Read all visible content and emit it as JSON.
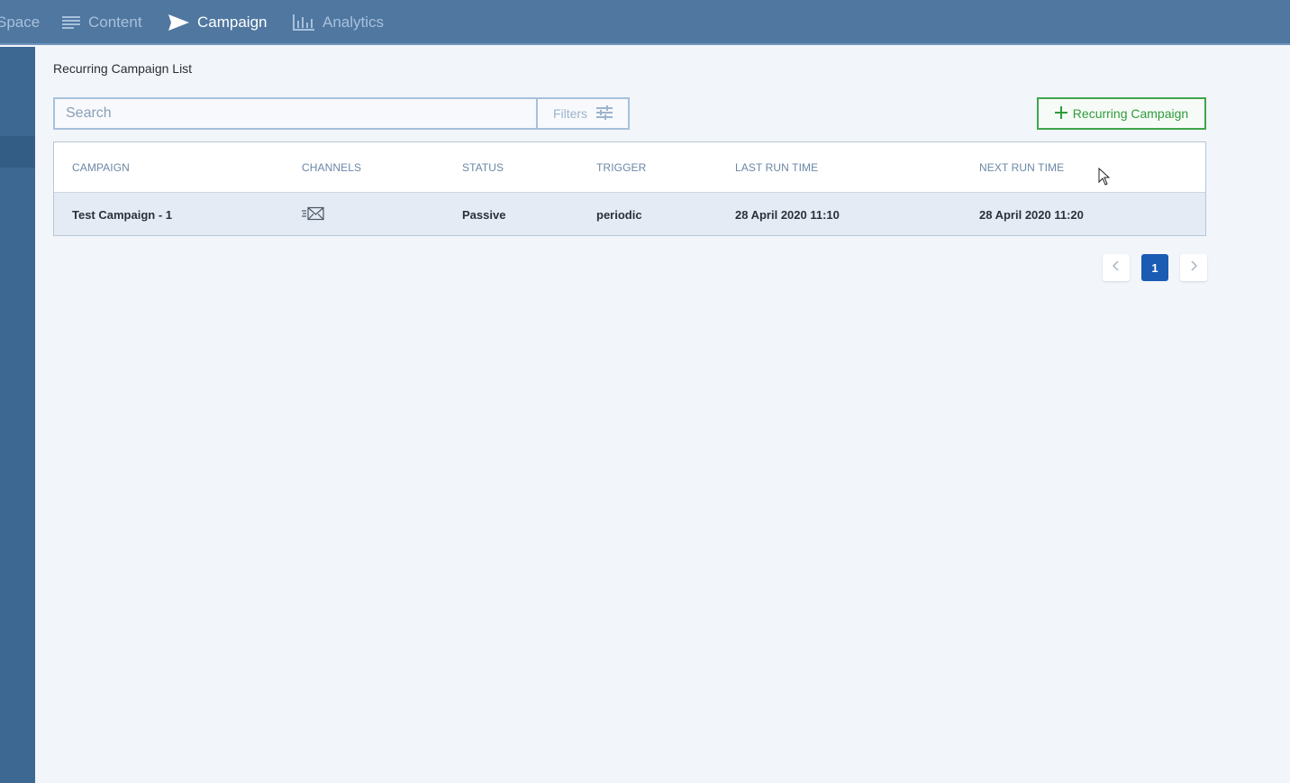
{
  "nav": {
    "items": [
      {
        "label": "Space",
        "icon": "workspace-icon",
        "active": false
      },
      {
        "label": "Content",
        "icon": "content-lines-icon",
        "active": false
      },
      {
        "label": "Campaign",
        "icon": "paper-plane-icon",
        "active": true
      },
      {
        "label": "Analytics",
        "icon": "bar-chart-icon",
        "active": false
      }
    ]
  },
  "page": {
    "title": "Recurring Campaign List"
  },
  "toolbar": {
    "search_placeholder": "Search",
    "search_value": "",
    "filters_label": "Filters",
    "add_label": "Recurring Campaign"
  },
  "table": {
    "columns": [
      "CAMPAIGN",
      "CHANNELS",
      "STATUS",
      "TRIGGER",
      "LAST RUN TIME",
      "NEXT RUN TIME"
    ],
    "rows": [
      {
        "campaign": "Test Campaign - 1",
        "channel_icon": "email-icon",
        "status": "Passive",
        "trigger": "periodic",
        "last_run": "28 April 2020 11:10",
        "next_run": "28 April 2020 11:20"
      }
    ]
  },
  "pagination": {
    "current_page": "1"
  },
  "colors": {
    "topbar": "#4f77a0",
    "sidebar": "#3c6891",
    "accent_green": "#3ea54b",
    "page_active": "#1a5bb3"
  }
}
